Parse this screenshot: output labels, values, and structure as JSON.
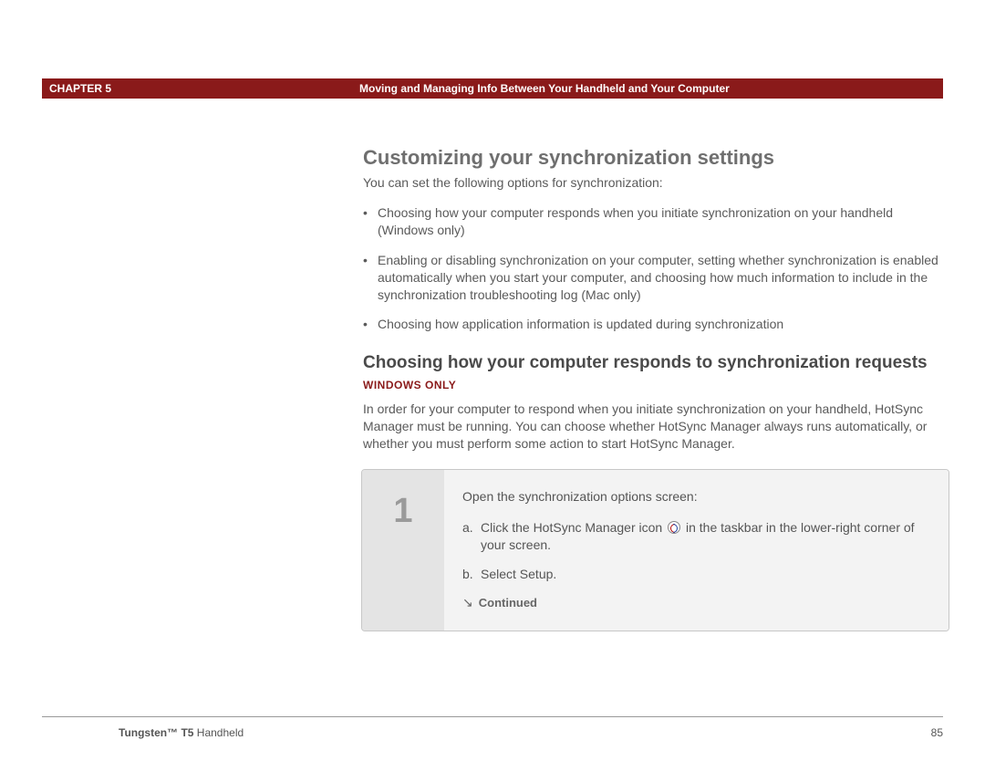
{
  "header": {
    "chapter": "CHAPTER 5",
    "title": "Moving and Managing Info Between Your Handheld and Your Computer"
  },
  "section": {
    "h1": "Customizing your synchronization settings",
    "intro": "You can set the following options for synchronization:",
    "bullets": [
      "Choosing how your computer responds when you initiate synchronization on your handheld (Windows only)",
      "Enabling or disabling synchronization on your computer, setting whether synchronization is enabled automatically when you start your computer, and choosing how much information to include in the synchronization troubleshooting log (Mac only)",
      "Choosing how application information is updated during synchronization"
    ],
    "h2": "Choosing how your computer responds to synchronization requests",
    "badge": "WINDOWS ONLY",
    "para": "In order for your computer to respond when you initiate synchronization on your handheld, HotSync Manager must be running. You can choose whether HotSync Manager always runs automatically, or whether you must perform some action to start HotSync Manager."
  },
  "step": {
    "number": "1",
    "title": "Open the synchronization options screen:",
    "a_label": "a.",
    "a_pre": "Click the HotSync Manager icon",
    "a_post": "in the taskbar in the lower-right corner of your screen.",
    "b_label": "b.",
    "b_text": "Select Setup.",
    "continued": "Continued"
  },
  "footer": {
    "product_bold": "Tungsten™ T5",
    "product_rest": " Handheld",
    "page": "85"
  }
}
